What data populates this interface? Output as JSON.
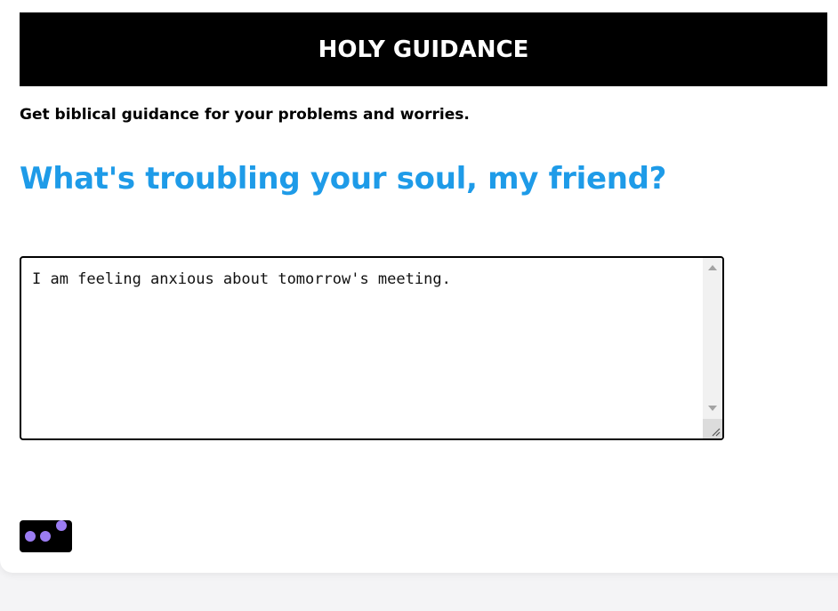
{
  "header": {
    "title": "HOLY GUIDANCE"
  },
  "intro": {
    "subtitle": "Get biblical guidance for your problems and worries."
  },
  "main": {
    "question": "What's troubling your soul, my friend?",
    "input": {
      "value": "I am feeling anxious about tomorrow's meeting.",
      "placeholder": ""
    },
    "submit_button": {
      "icon": "loading-dots-icon",
      "state": "loading"
    }
  },
  "colors": {
    "header_bg": "#000000",
    "question": "#1e9be8",
    "loading_dots": "#9b7cf2"
  }
}
